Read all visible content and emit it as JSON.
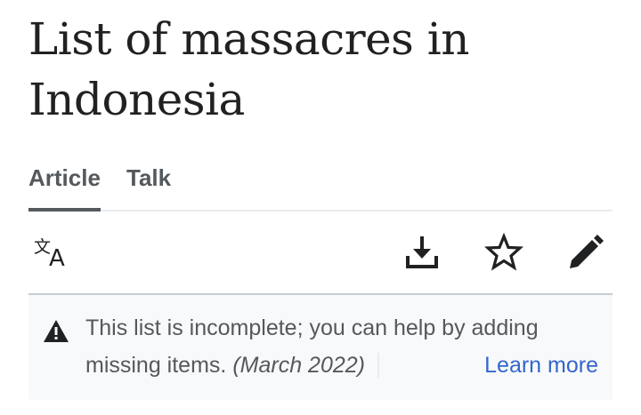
{
  "page": {
    "title": "List of massacres in Indonesia"
  },
  "tabs": [
    {
      "label": "Article",
      "selected": true
    },
    {
      "label": "Talk",
      "selected": false
    }
  ],
  "toolbar": {
    "icons": [
      "language-icon",
      "download-icon",
      "star-icon",
      "edit-pencil-icon"
    ]
  },
  "notice": {
    "icon": "warning-icon",
    "text": "This list is incomplete; you can help by adding missing items.",
    "date": "(March 2022)",
    "link_label": "Learn more"
  },
  "colors": {
    "text": "#202122",
    "tab_text": "#54595d",
    "link": "#3366cc",
    "notice_background": "#f8f9fa"
  }
}
